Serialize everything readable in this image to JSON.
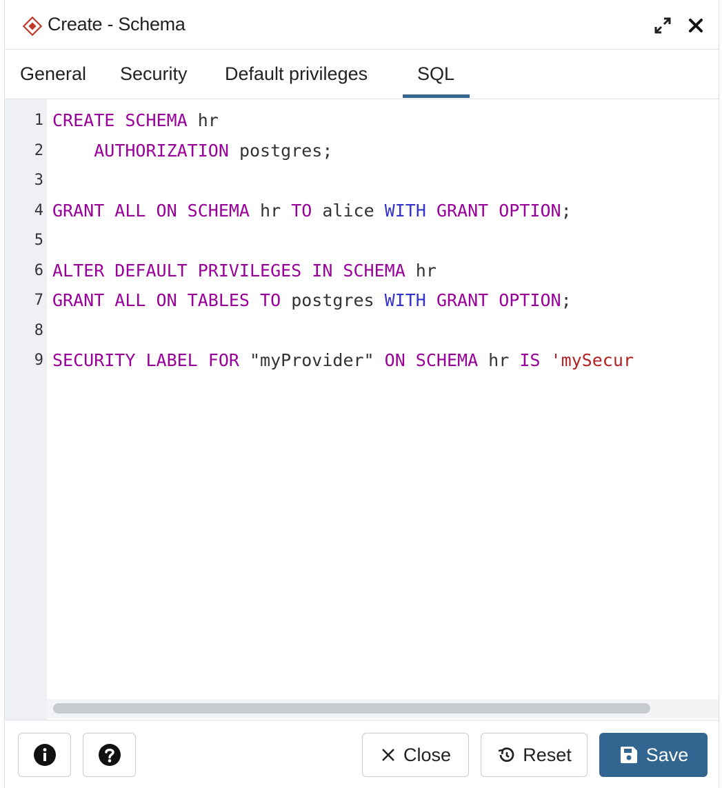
{
  "dialog": {
    "title": "Create - Schema"
  },
  "tabs": [
    {
      "label": "General"
    },
    {
      "label": "Security"
    },
    {
      "label": "Default privileges"
    },
    {
      "label": "SQL",
      "active": true
    }
  ],
  "editor": {
    "line_numbers": [
      "1",
      "2",
      "3",
      "4",
      "5",
      "6",
      "7",
      "8",
      "9"
    ],
    "lines": [
      [
        {
          "t": "CREATE SCHEMA",
          "c": "kw"
        },
        {
          "t": " hr",
          "c": ""
        }
      ],
      [
        {
          "t": "    ",
          "c": ""
        },
        {
          "t": "AUTHORIZATION",
          "c": "kw"
        },
        {
          "t": " postgres;",
          "c": ""
        }
      ],
      [],
      [
        {
          "t": "GRANT ALL ON SCHEMA",
          "c": "kw"
        },
        {
          "t": " hr ",
          "c": ""
        },
        {
          "t": "TO",
          "c": "kw"
        },
        {
          "t": " alice ",
          "c": ""
        },
        {
          "t": "WITH",
          "c": "kw2"
        },
        {
          "t": " ",
          "c": ""
        },
        {
          "t": "GRANT OPTION",
          "c": "kw"
        },
        {
          "t": ";",
          "c": ""
        }
      ],
      [],
      [
        {
          "t": "ALTER DEFAULT PRIVILEGES IN SCHEMA",
          "c": "kw"
        },
        {
          "t": " hr",
          "c": ""
        }
      ],
      [
        {
          "t": "GRANT ALL ON TABLES TO",
          "c": "kw"
        },
        {
          "t": " postgres ",
          "c": ""
        },
        {
          "t": "WITH",
          "c": "kw2"
        },
        {
          "t": " ",
          "c": ""
        },
        {
          "t": "GRANT OPTION",
          "c": "kw"
        },
        {
          "t": ";",
          "c": ""
        }
      ],
      [],
      [
        {
          "t": "SECURITY LABEL FOR",
          "c": "kw"
        },
        {
          "t": " \"myProvider\" ",
          "c": ""
        },
        {
          "t": "ON SCHEMA",
          "c": "kw"
        },
        {
          "t": " hr ",
          "c": ""
        },
        {
          "t": "IS",
          "c": "kw"
        },
        {
          "t": " ",
          "c": ""
        },
        {
          "t": "'mySecur",
          "c": "str"
        }
      ]
    ]
  },
  "footer": {
    "close_label": "Close",
    "reset_label": "Reset",
    "save_label": "Save"
  },
  "colors": {
    "accent": "#326690",
    "keyword": "#990099",
    "keyword_alt": "#3333cc",
    "string": "#b22222",
    "brand_icon": "#c0392b"
  },
  "icons": {
    "title": "schema-diamond-icon",
    "expand": "expand-arrows-icon",
    "close": "close-x-icon",
    "info": "info-circle-icon",
    "help": "help-question-icon",
    "close_button": "x-icon",
    "reset": "reset-history-icon",
    "save": "floppy-disk-icon"
  }
}
